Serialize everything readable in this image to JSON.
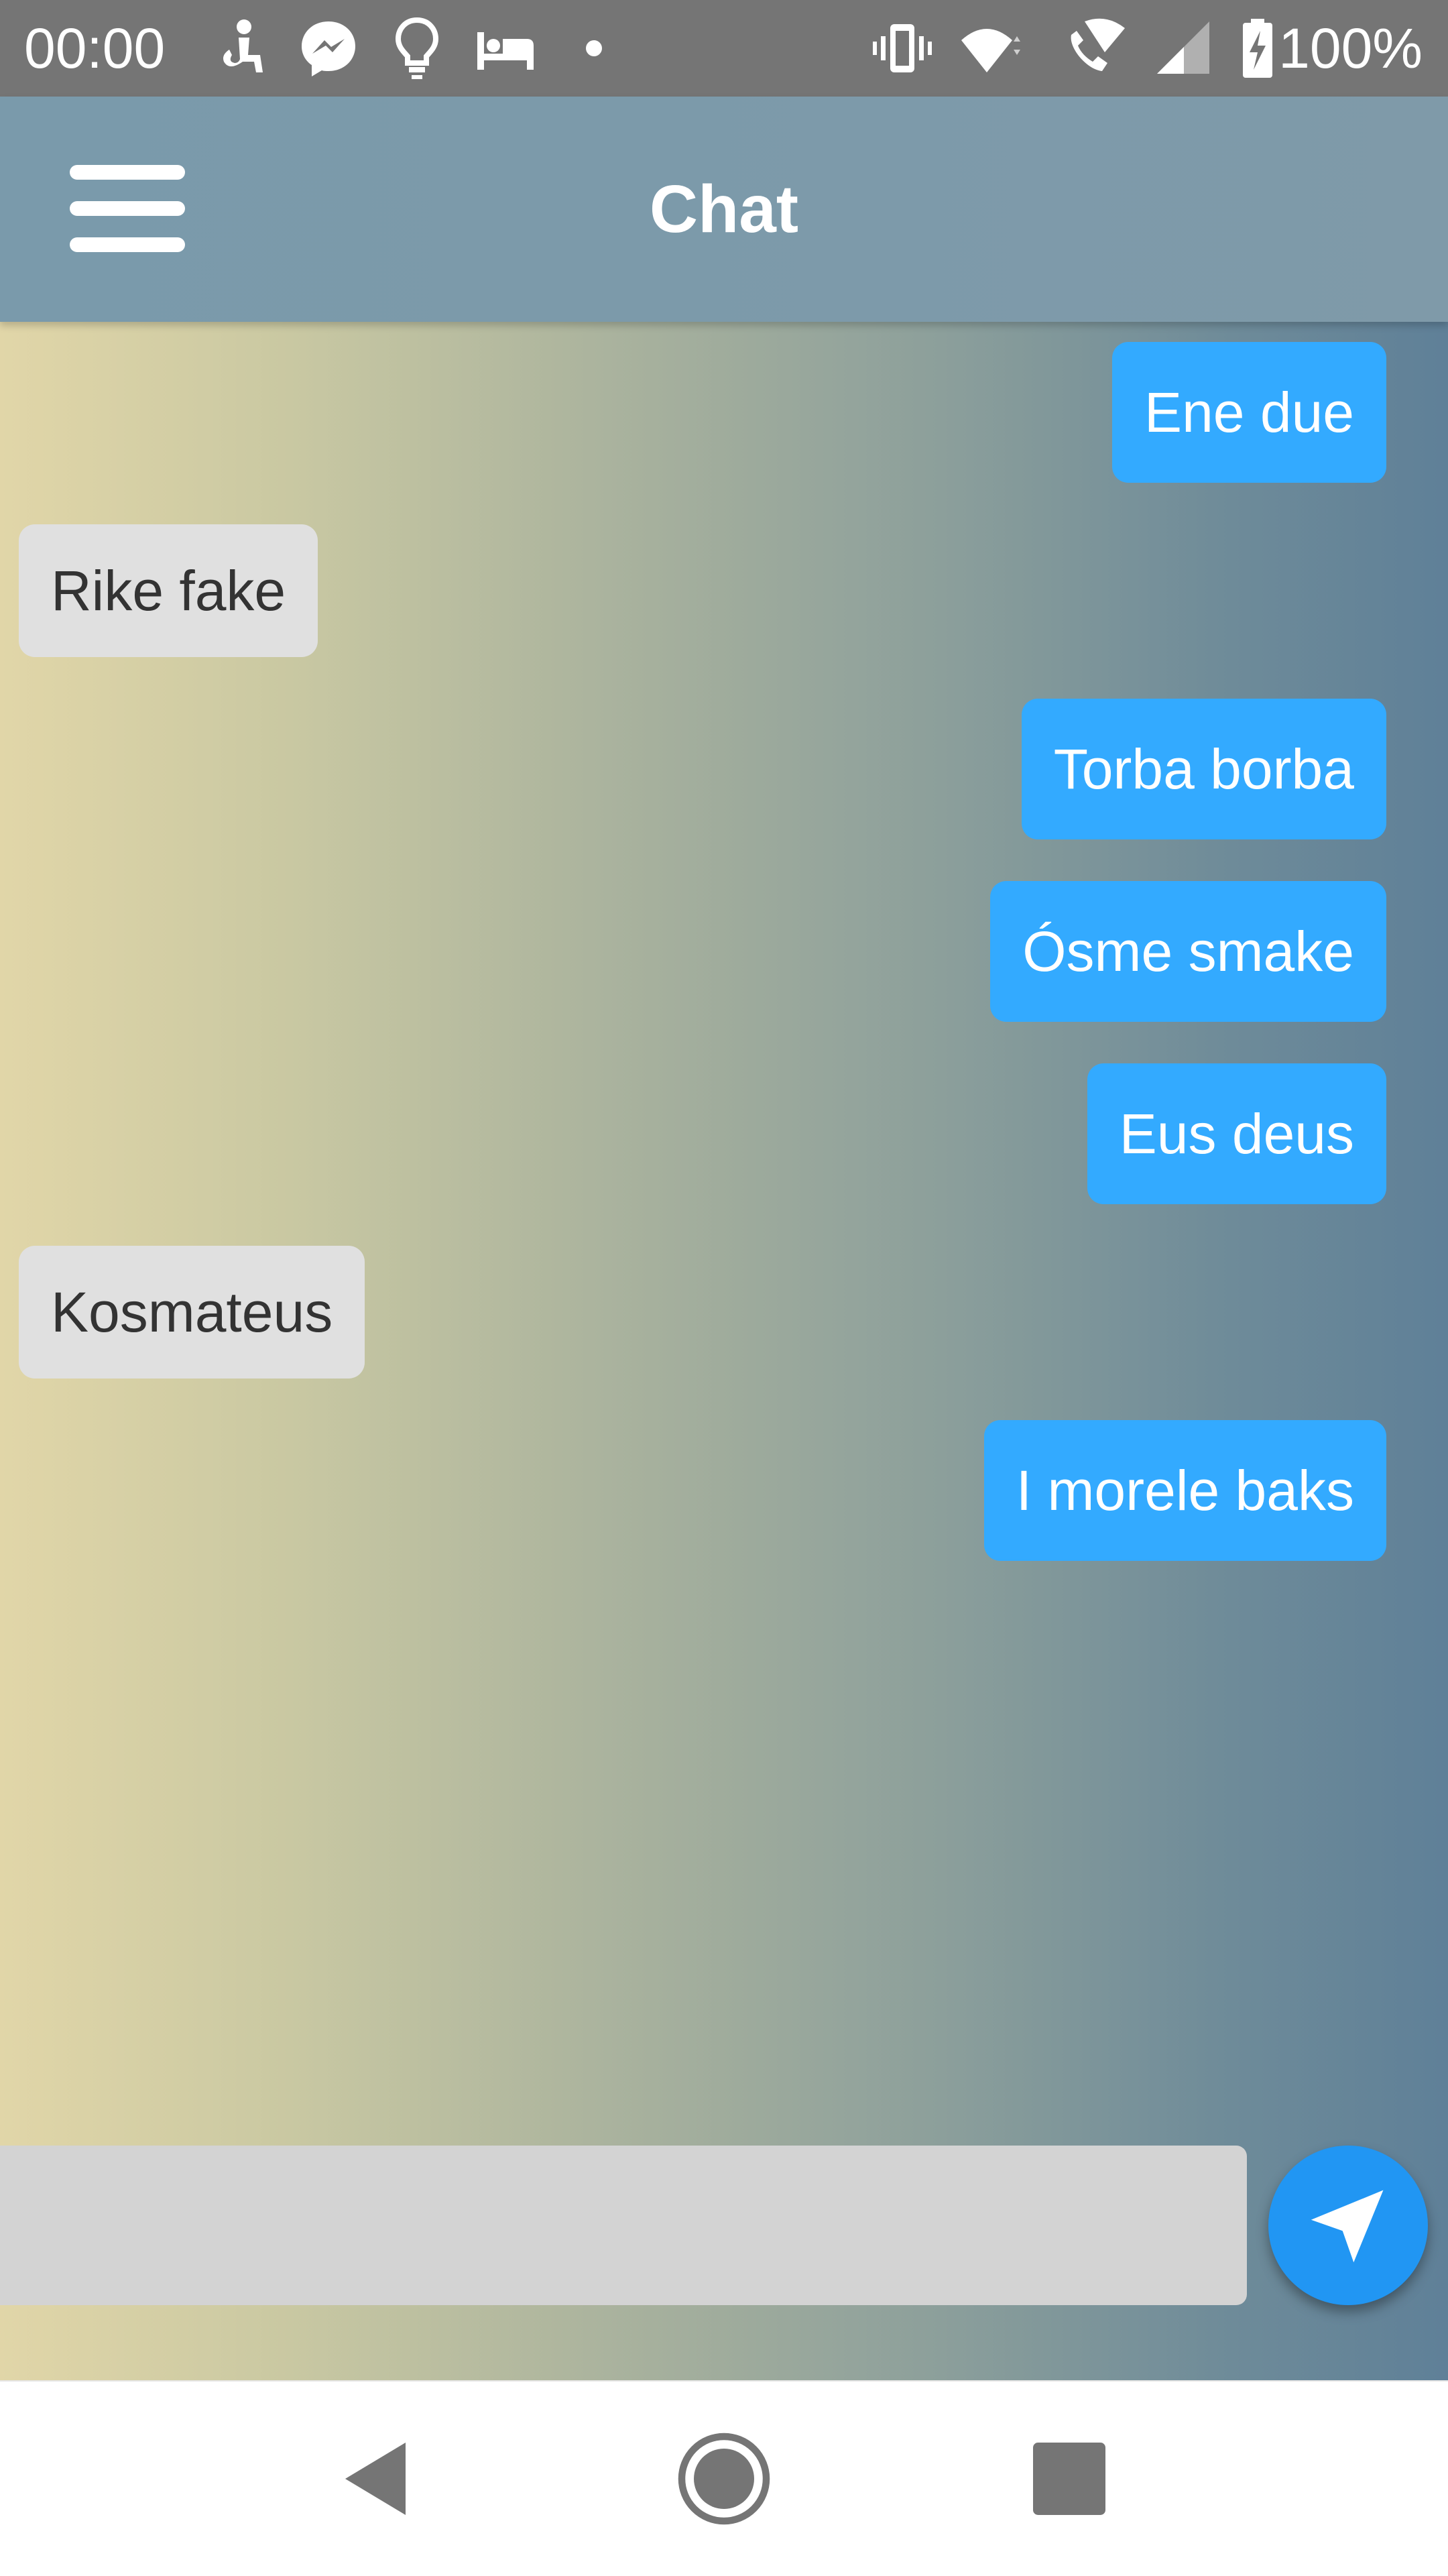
{
  "status_bar": {
    "time": "00:00",
    "battery_percent": "100%",
    "icons": [
      "accessibility-icon",
      "messenger-icon",
      "lightbulb-icon",
      "hotel-icon",
      "notification-dot-icon",
      "vibrate-icon",
      "wifi-icon",
      "wifi-calling-icon",
      "cell-signal-icon",
      "battery-charging-icon"
    ]
  },
  "header": {
    "title": "Chat",
    "menu_icon": "hamburger-menu-icon"
  },
  "messages": [
    {
      "text": "Ene due",
      "direction": "out"
    },
    {
      "text": "Rike fake",
      "direction": "in"
    },
    {
      "text": "Torba borba",
      "direction": "out"
    },
    {
      "text": "Ósme smake",
      "direction": "out"
    },
    {
      "text": "Eus deus",
      "direction": "out"
    },
    {
      "text": "Kosmateus",
      "direction": "in"
    },
    {
      "text": "I morele baks",
      "direction": "out"
    }
  ],
  "composer": {
    "value": "",
    "placeholder": "",
    "send_icon": "send-arrow-icon"
  },
  "colors": {
    "outgoing_bubble": "#33aaff",
    "incoming_bubble": "#e0e0e0",
    "send_button": "#2196f3",
    "app_bar": "#7a9aab"
  },
  "nav_bar": {
    "icons": [
      "back-icon",
      "home-icon",
      "recents-icon"
    ]
  }
}
